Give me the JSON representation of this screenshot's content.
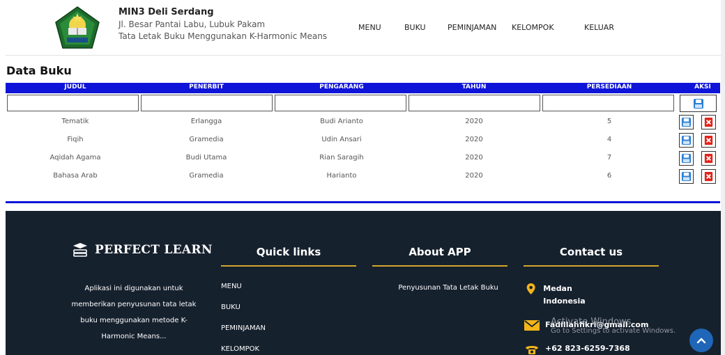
{
  "header": {
    "school_name": "MIN3 Deli Serdang",
    "address": "Jl. Besar Pantai Labu, Lubuk Pakam",
    "app_subtitle": "Tata Letak Buku Menggunakan K-Harmonic Means",
    "nav": [
      "MENU",
      "BUKU",
      "PEMINJAMAN",
      "KELOMPOK",
      "KELUAR"
    ]
  },
  "page_title": "Data Buku",
  "table": {
    "columns": [
      "JUDUL",
      "PENERBIT",
      "PENGARANG",
      "TAHUN",
      "PERSEDIAAN",
      "AKSI"
    ],
    "rows": [
      [
        "Tematik",
        "Erlangga",
        "Budi Arianto",
        "2020",
        "5"
      ],
      [
        "Fiqih",
        "Gramedia",
        "Udin Ansari",
        "2020",
        "4"
      ],
      [
        "Aqidah Agama",
        "Budi Utama",
        "Rian Saragih",
        "2020",
        "7"
      ],
      [
        "Bahasa Arab",
        "Gramedia",
        "Harianto",
        "2020",
        "6"
      ]
    ]
  },
  "footer": {
    "brand": "PERFECT LEARN",
    "description": "Aplikasi ini digunakan untuk memberikan penyusunan tata letak buku menggunakan metode K-Harmonic Means...",
    "quick_links_title": "Quick links",
    "quick_links": [
      "MENU",
      "BUKU",
      "PEMINJAMAN",
      "KELOMPOK"
    ],
    "about_title": "About APP",
    "about_text": "Penyusunan Tata Letak Buku",
    "contact_title": "Contact us",
    "contact_location": "Medan Indonesia",
    "contact_email": "Fadillahfikri@gmail.com",
    "contact_phone": "+62 823-6259-7368"
  },
  "os_overlay": {
    "activate": "Activate Windows",
    "activate_sub": "Go to Settings to activate Windows."
  },
  "colors": {
    "table_header": "#0f15d8",
    "footer_bg": "#16212e",
    "accent_gold": "#d4a62c",
    "delete_red": "#e0241b",
    "save_blue": "#2a7fd4"
  },
  "icons": [
    "school-logo-icon",
    "book-stack-icon",
    "floppy-save-icon",
    "delete-x-icon",
    "location-pin-icon",
    "mail-icon",
    "phone-icon",
    "chevron-up-icon"
  ]
}
